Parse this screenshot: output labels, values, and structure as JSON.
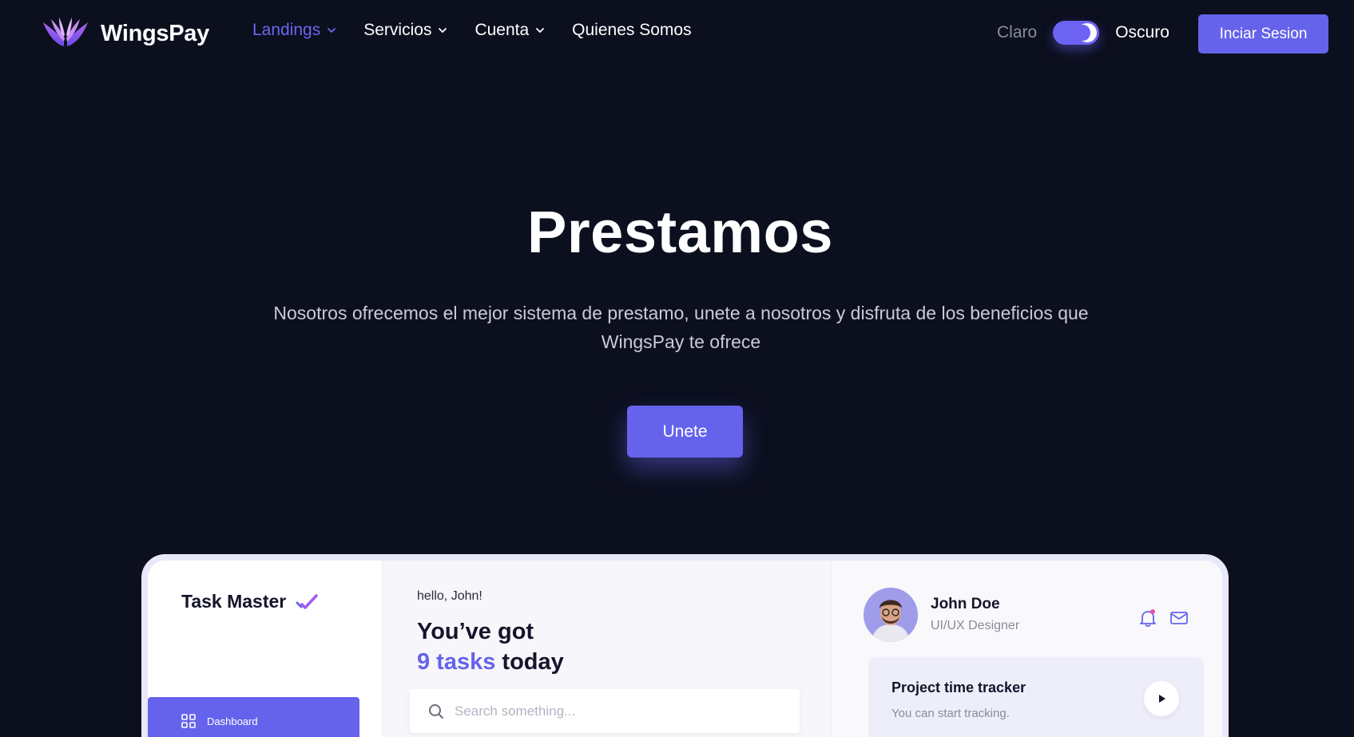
{
  "brand": {
    "name": "WingsPay",
    "accent": "#6563eb"
  },
  "nav": {
    "items": [
      {
        "label": "Landings",
        "dropdown": true,
        "active": true
      },
      {
        "label": "Servicios",
        "dropdown": true,
        "active": false
      },
      {
        "label": "Cuenta",
        "dropdown": true,
        "active": false
      },
      {
        "label": "Quienes Somos",
        "dropdown": false,
        "active": false
      }
    ],
    "theme": {
      "light_label": "Claro",
      "dark_label": "Oscuro",
      "dark_enabled": true
    },
    "login_label": "Inciar Sesion"
  },
  "hero": {
    "title": "Prestamos",
    "subtitle": "Nosotros ofrecemos el mejor sistema de prestamo, unete a nosotros y disfruta de los beneficios que WingsPay te ofrece",
    "cta_label": "Unete"
  },
  "preview": {
    "app_title": "Task Master",
    "sidebar_item": "Dashboard",
    "greeting": "hello, John!",
    "tasks_prefix": "You’ve got",
    "tasks_count": "9 tasks",
    "tasks_suffix": "today",
    "search_placeholder": "Search something...",
    "user": {
      "name": "John Doe",
      "role": "UI/UX Designer"
    },
    "tracker": {
      "title": "Project time tracker",
      "subtitle": "You can start tracking."
    }
  }
}
